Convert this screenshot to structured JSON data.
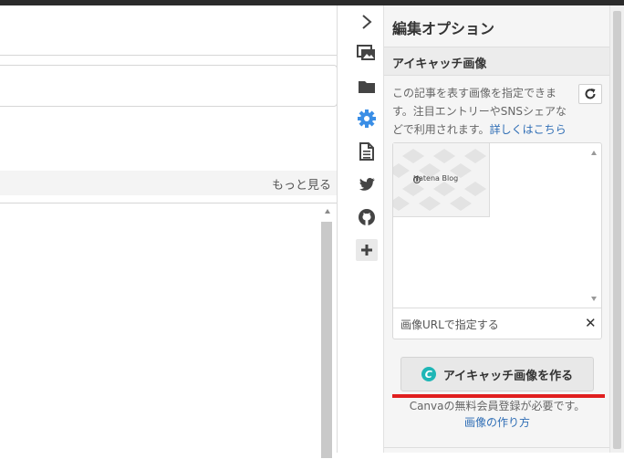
{
  "editor": {
    "more_link": "もっと見る"
  },
  "panel": {
    "title": "編集オプション",
    "section_title": "アイキャッチ画像",
    "description": "この記事を表す画像を指定できます。注目エントリーやSNSシェアなどで利用されます。",
    "details_link": "詳しくはこちら",
    "thumbnail_logo_text": "Hatena Blog",
    "url_label": "画像URLで指定する",
    "url_close": "✕",
    "canva_button_label": "アイキャッチ画像を作る",
    "canva_icon_letter": "C",
    "note_text": "Canvaの無料会員登録が必要です。",
    "howto_link": "画像の作り方"
  },
  "iconbar": {
    "icons": [
      "chevron-right-icon",
      "photo-icon",
      "folder-icon",
      "gear-icon",
      "document-icon",
      "twitter-icon",
      "github-icon",
      "plus-icon"
    ]
  },
  "colors": {
    "accent_blue": "#2e6db5",
    "gear_blue": "#3a8ee6",
    "canva_teal": "#1fb6b6",
    "highlight_red": "#e01f1f"
  }
}
